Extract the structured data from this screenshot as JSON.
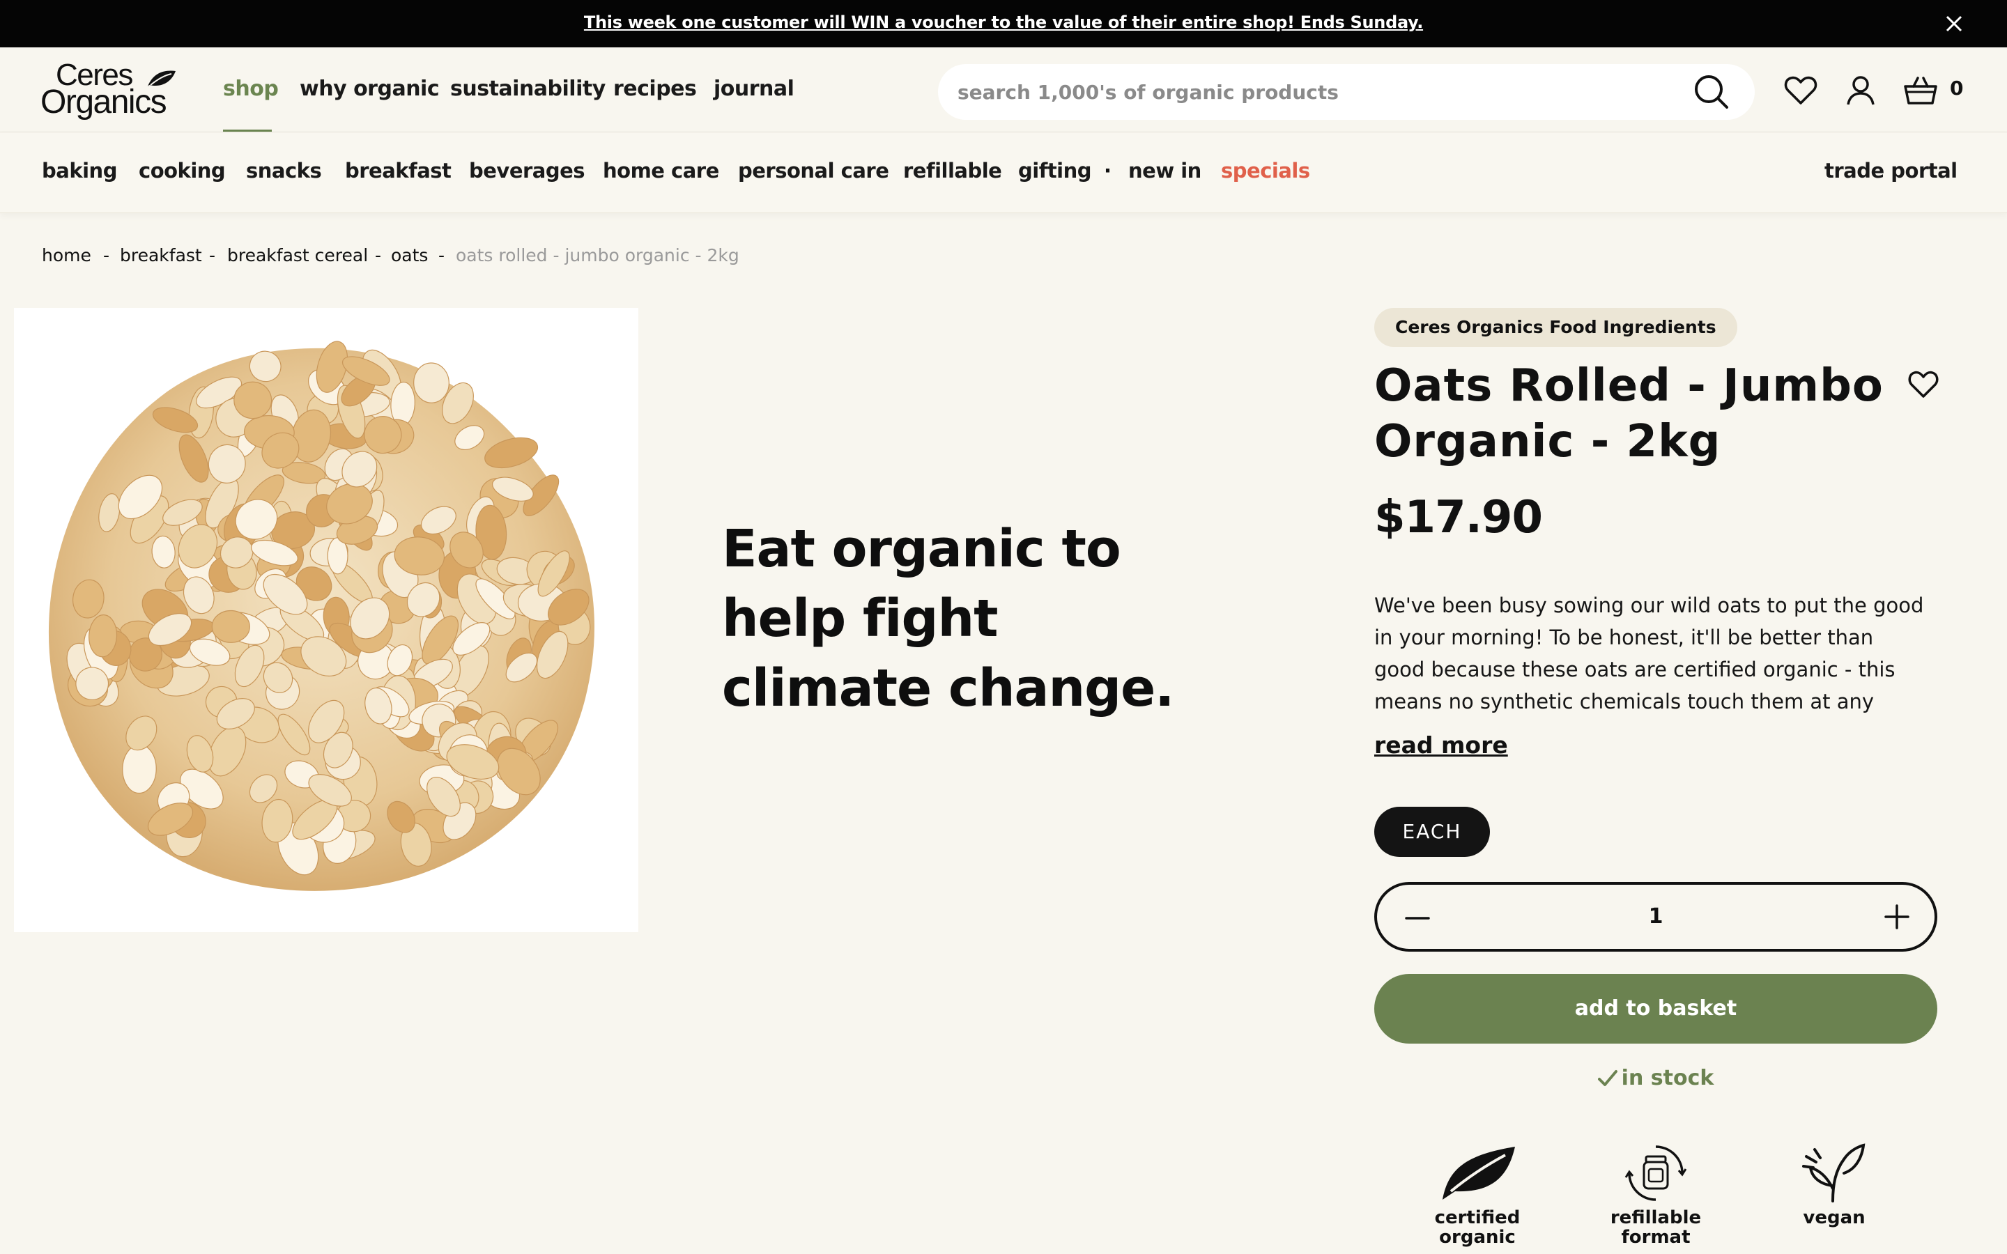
{
  "announcement": {
    "text": "This week one customer will WIN a voucher to the value of their entire shop! Ends Sunday."
  },
  "brand": {
    "line1": "Ceres",
    "line2": "Organics"
  },
  "main_nav": [
    "shop",
    "why organic",
    "sustainability",
    "recipes",
    "journal"
  ],
  "search": {
    "placeholder": "search 1,000's of organic products"
  },
  "cart": {
    "count": "0"
  },
  "categories": [
    "baking",
    "cooking",
    "snacks",
    "breakfast",
    "beverages",
    "home care",
    "personal care",
    "refillable",
    "gifting",
    "new in",
    "specials"
  ],
  "trade_portal": "trade portal",
  "breadcrumb": [
    "home",
    "breakfast",
    "breakfast cereal",
    "oats",
    "oats rolled - jumbo organic - 2kg"
  ],
  "tagline": "Eat organic to help fight climate change.",
  "product": {
    "brand_tag": "Ceres Organics Food Ingredients",
    "title": "Oats Rolled - Jumbo Organic - 2kg",
    "price": "$17.90",
    "description": "We've been busy sowing our wild oats to put the good in your morning! To be honest, it'll be better than good because these oats are certified organic - this means no synthetic chemicals touch them at any point of",
    "read_more": "read more",
    "unit": "EACH",
    "quantity": "1",
    "add_to_basket": "add to basket",
    "stock_status": "in stock",
    "attributes": [
      "certified organic",
      "refillable format",
      "vegan"
    ]
  },
  "colors": {
    "accent_green": "#6b8250",
    "specials_red": "#e0604a",
    "background": "#f8f6ef",
    "announcement_bg": "#050505"
  }
}
